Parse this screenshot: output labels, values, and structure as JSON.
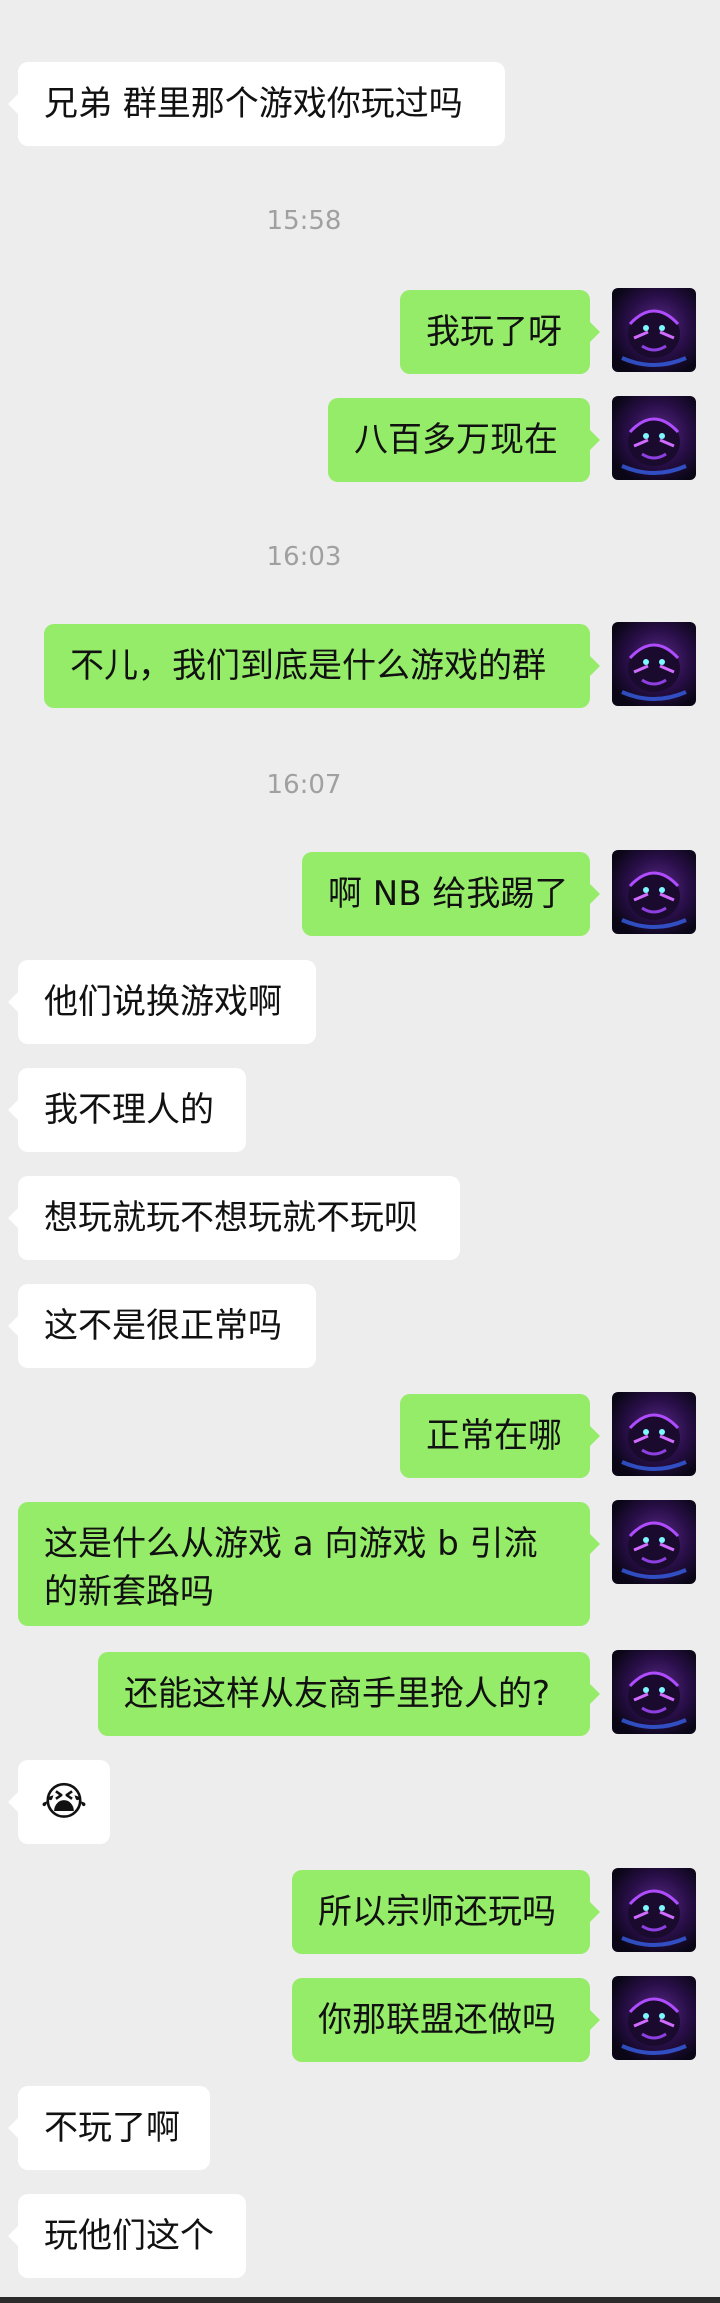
{
  "messages": [
    {
      "text": "兄弟 群里那个游戏你玩过吗"
    },
    {
      "text": "我玩了呀"
    },
    {
      "text": "八百多万现在"
    },
    {
      "text": "不儿，我们到底是什么游戏的群"
    },
    {
      "text": "啊 NB 给我踢了"
    },
    {
      "text": "他们说换游戏啊"
    },
    {
      "text": "我不理人的"
    },
    {
      "text": "想玩就玩不想玩就不玩呗"
    },
    {
      "text": "这不是很正常吗"
    },
    {
      "text": "正常在哪"
    },
    {
      "text": "这是什么从游戏 a 向游戏 b 引流的新套路吗"
    },
    {
      "text": "还能这样从友商手里抢人的?"
    },
    {
      "text": "😭"
    },
    {
      "text": "所以宗师还玩吗"
    },
    {
      "text": "你那联盟还做吗"
    },
    {
      "text": "不玩了啊"
    },
    {
      "text": "玩他们这个"
    }
  ],
  "timestamps": [
    "15:58",
    "16:03",
    "16:07"
  ],
  "avatar": {
    "icon": "tiger-avatar-icon"
  },
  "colors": {
    "background": "#ededed",
    "outgoing_bubble": "#95ec69",
    "incoming_bubble": "#ffffff",
    "timestamp_text": "#a0a0a0"
  }
}
